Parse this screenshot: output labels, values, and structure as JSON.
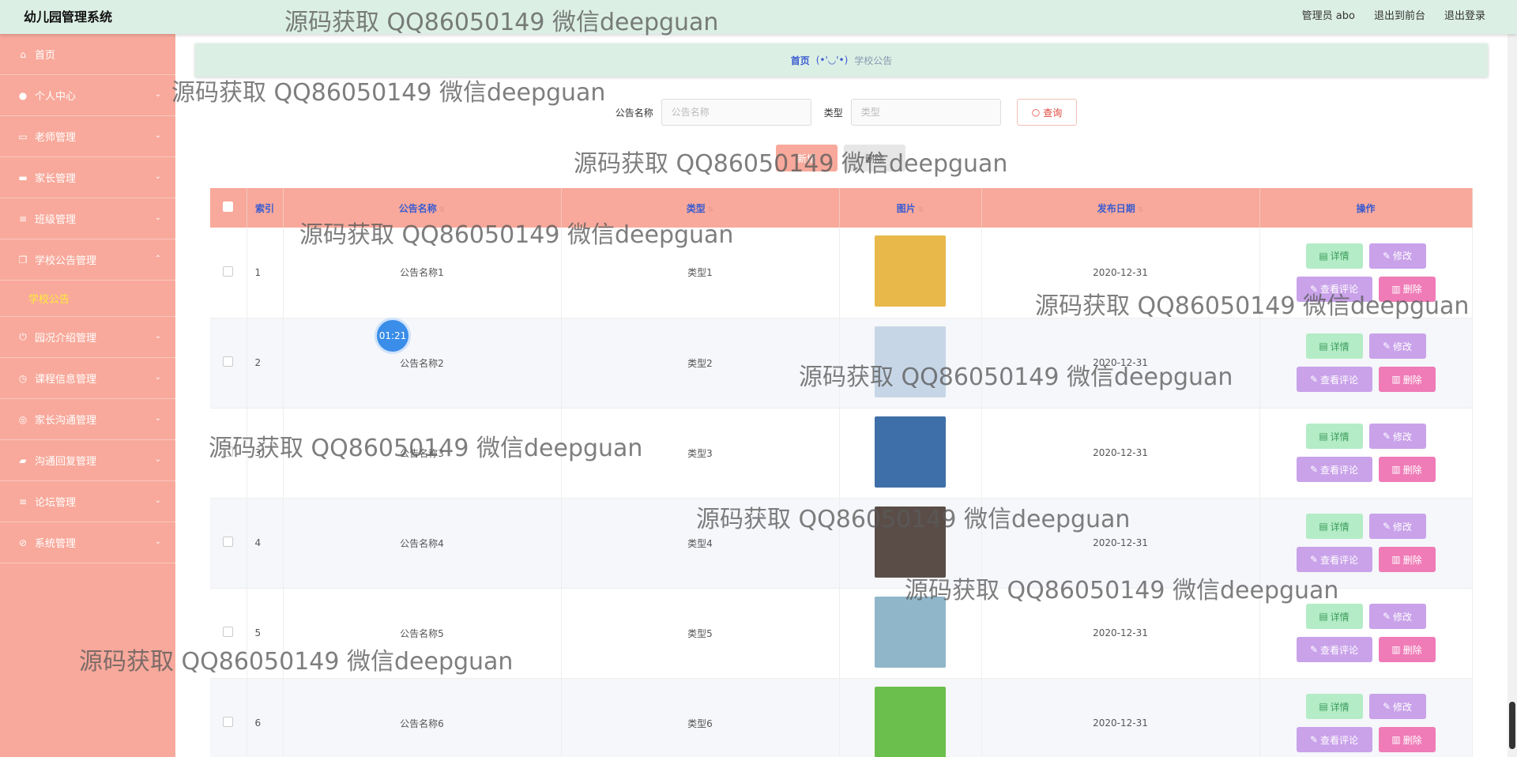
{
  "app": {
    "title": "幼儿园管理系统"
  },
  "top_links": [
    "管理员 abo",
    "退出到前台",
    "退出登录"
  ],
  "sidebar": {
    "items": [
      {
        "label": "首页",
        "icon": "home-icon",
        "glyph": "⌂",
        "chevron": ""
      },
      {
        "label": "个人中心",
        "icon": "user-icon",
        "glyph": "●",
        "chevron": "⌄"
      },
      {
        "label": "老师管理",
        "icon": "chat-icon",
        "glyph": "▭",
        "chevron": "⌄"
      },
      {
        "label": "家长管理",
        "icon": "monitor-icon",
        "glyph": "▬",
        "chevron": "⌄"
      },
      {
        "label": "班级管理",
        "icon": "list-icon",
        "glyph": "≡",
        "chevron": "⌄"
      },
      {
        "label": "学校公告管理",
        "icon": "copy-icon",
        "glyph": "❐",
        "chevron": "⌃"
      },
      {
        "label": "园况介绍管理",
        "icon": "power-icon",
        "glyph": "⏻",
        "chevron": "⌄"
      },
      {
        "label": "课程信息管理",
        "icon": "clock-icon",
        "glyph": "◷",
        "chevron": "⌄"
      },
      {
        "label": "家长沟通管理",
        "icon": "target-icon",
        "glyph": "◎",
        "chevron": "⌄"
      },
      {
        "label": "沟通回复管理",
        "icon": "briefcase-icon",
        "glyph": "▰",
        "chevron": "⌄"
      },
      {
        "label": "论坛管理",
        "icon": "menu-icon",
        "glyph": "≡",
        "chevron": "⌄"
      },
      {
        "label": "系统管理",
        "icon": "bell-off-icon",
        "glyph": "⊘",
        "chevron": "⌄"
      }
    ],
    "active_sub": "学校公告"
  },
  "breadcrumb": {
    "home": "首页",
    "separator": "(•'◡'•)",
    "current": "学校公告"
  },
  "search": {
    "name_label": "公告名称",
    "name_placeholder": "公告名称",
    "type_label": "类型",
    "type_placeholder": "类型",
    "query_label": "查询",
    "query_icon": "search-icon"
  },
  "actions": {
    "add_label": "新增",
    "delete_label": "删除"
  },
  "table": {
    "headers": [
      "索引",
      "公告名称",
      "类型",
      "图片",
      "发布日期",
      "操作"
    ],
    "rows": [
      {
        "index": "1",
        "name": "公告名称1",
        "type": "类型1",
        "date": "2020-12-31",
        "img": "#e8b84a"
      },
      {
        "index": "2",
        "name": "公告名称2",
        "type": "类型2",
        "date": "2020-12-31",
        "img": "#c7d6e6"
      },
      {
        "index": "3",
        "name": "公告名称3",
        "type": "类型3",
        "date": "2020-12-31",
        "img": "#3f6fa8"
      },
      {
        "index": "4",
        "name": "公告名称4",
        "type": "类型4",
        "date": "2020-12-31",
        "img": "#5a4d48"
      },
      {
        "index": "5",
        "name": "公告名称5",
        "type": "类型5",
        "date": "2020-12-31",
        "img": "#8fb7c9"
      },
      {
        "index": "6",
        "name": "公告名称6",
        "type": "类型6",
        "date": "2020-12-31",
        "img": "#6bbf4c"
      }
    ],
    "op_labels": {
      "detail": "详情",
      "edit": "修改",
      "comment": "查看评论",
      "delete": "删除"
    }
  },
  "watermark": "源码获取 QQ86050149 微信deepguan",
  "timer": "01:21"
}
